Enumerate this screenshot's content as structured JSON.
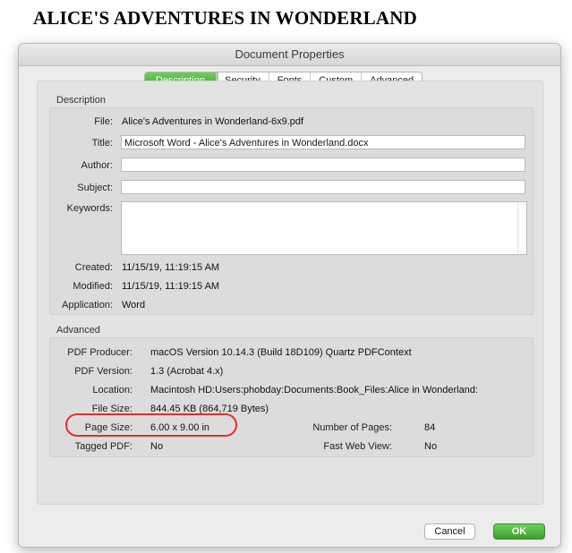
{
  "document": {
    "heading": "ALICE'S ADVENTURES  IN WONDERLAND"
  },
  "dialog": {
    "title": "Document Properties",
    "tabs": [
      {
        "label": "Description",
        "active": true
      },
      {
        "label": "Security",
        "active": false
      },
      {
        "label": "Fonts",
        "active": false
      },
      {
        "label": "Custom",
        "active": false
      },
      {
        "label": "Advanced",
        "active": false
      }
    ],
    "description": {
      "section_label": "Description",
      "file_label": "File:",
      "file_value": "Alice's Adventures in Wonderland-6x9.pdf",
      "title_label": "Title:",
      "title_value": "Microsoft Word - Alice's Adventures in Wonderland.docx",
      "author_label": "Author:",
      "author_value": "",
      "subject_label": "Subject:",
      "subject_value": "",
      "keywords_label": "Keywords:",
      "keywords_value": "",
      "created_label": "Created:",
      "created_value": "11/15/19, 11:19:15 AM",
      "modified_label": "Modified:",
      "modified_value": "11/15/19, 11:19:15 AM",
      "application_label": "Application:",
      "application_value": "Word"
    },
    "advanced": {
      "section_label": "Advanced",
      "producer_label": "PDF Producer:",
      "producer_value": "macOS Version 10.14.3 (Build 18D109) Quartz PDFContext",
      "version_label": "PDF Version:",
      "version_value": "1.3 (Acrobat 4.x)",
      "location_label": "Location:",
      "location_value": "Macintosh HD:Users:phobday:Documents:Book_Files:Alice in Wonderland:",
      "filesize_label": "File Size:",
      "filesize_value": "844.45 KB (864,719 Bytes)",
      "pagesize_label": "Page Size:",
      "pagesize_value": "6.00 x 9.00 in",
      "numpages_label": "Number of Pages:",
      "numpages_value": "84",
      "tagged_label": "Tagged PDF:",
      "tagged_value": "No",
      "fastweb_label": "Fast Web View:",
      "fastweb_value": "No"
    },
    "buttons": {
      "cancel": "Cancel",
      "ok": "OK"
    },
    "colors": {
      "accent_green": "#4caf3a",
      "highlight_red": "#e0302a"
    }
  }
}
